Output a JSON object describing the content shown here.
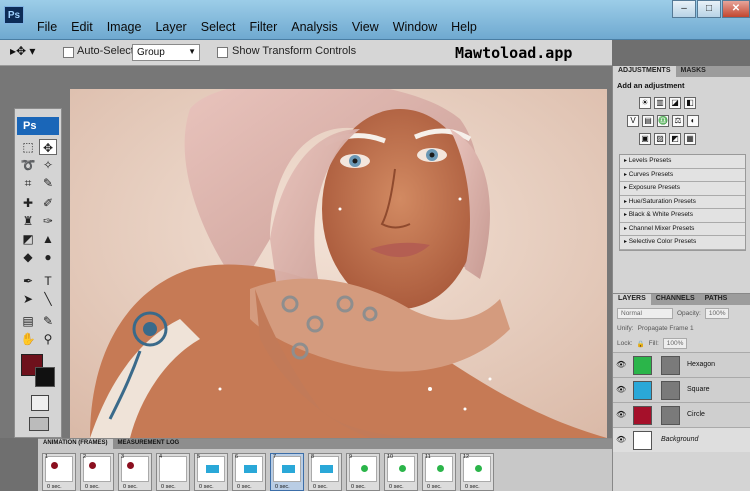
{
  "app": {
    "logo": "Ps"
  },
  "menu": [
    "File",
    "Edit",
    "Image",
    "Layer",
    "Select",
    "Filter",
    "Analysis",
    "View",
    "Window",
    "Help"
  ],
  "window_controls": {
    "minimize": "–",
    "maximize": "□",
    "close": "✕"
  },
  "options_bar": {
    "tool_preset": "▸✥ ▾",
    "auto_select_label": "Auto-Select:",
    "auto_select_value": "Group",
    "show_transform_label": "Show Transform Controls"
  },
  "watermark": "Mawtoload.app",
  "toolbox": {
    "badge": "Ps"
  },
  "colors": {
    "foreground": "#6e111c",
    "background": "#111111",
    "green": "#2bb54a",
    "cyan": "#2aa8d8",
    "red": "#a5102a"
  },
  "adjustments": {
    "tabs": [
      "ADJUSTMENTS",
      "MASKS"
    ],
    "title": "Add an adjustment",
    "row1": [
      "☀",
      "▥",
      "◪",
      "◧"
    ],
    "row2": [
      "V",
      "▤",
      "♎",
      "⚖",
      "◐"
    ],
    "row3": [
      "▣",
      "▨",
      "◩",
      "▦"
    ],
    "presets": [
      "Levels Presets",
      "Curves Presets",
      "Exposure Presets",
      "Hue/Saturation Presets",
      "Black & White Presets",
      "Channel Mixer Presets",
      "Selective Color Presets"
    ]
  },
  "layers_panel": {
    "tabs": [
      "LAYERS",
      "CHANNELS",
      "PATHS"
    ],
    "blend_mode": "Normal",
    "opacity_label": "Opacity:",
    "opacity_value": "100%",
    "unify_label": "Unify:",
    "propagate_label": "Propagate Frame 1",
    "lock_label": "Lock:",
    "fill_label": "Fill:",
    "fill_value": "100%",
    "layers": [
      {
        "name": "Hexagon",
        "color": "#2bb54a"
      },
      {
        "name": "Square",
        "color": "#2aa8d8"
      },
      {
        "name": "Circle",
        "color": "#a5102a"
      },
      {
        "name": "Background",
        "color": "#ffffff"
      }
    ]
  },
  "animation": {
    "tabs": [
      "ANIMATION (FRAMES)",
      "MEASUREMENT LOG"
    ],
    "frames": [
      {
        "num": "1",
        "delay": "0 sec.",
        "shape": "circle",
        "color": "#8b0f1f"
      },
      {
        "num": "2",
        "delay": "0 sec.",
        "shape": "circle",
        "color": "#8b0f1f"
      },
      {
        "num": "3",
        "delay": "0 sec.",
        "shape": "circle",
        "color": "#8b0f1f"
      },
      {
        "num": "4",
        "delay": "0 sec.",
        "shape": "none",
        "color": ""
      },
      {
        "num": "5",
        "delay": "0 sec.",
        "shape": "square",
        "color": "#2aa8d8"
      },
      {
        "num": "6",
        "delay": "0 sec.",
        "shape": "square",
        "color": "#2aa8d8"
      },
      {
        "num": "7",
        "delay": "0 sec.",
        "shape": "square",
        "color": "#2aa8d8"
      },
      {
        "num": "8",
        "delay": "0 sec.",
        "shape": "square",
        "color": "#2aa8d8"
      },
      {
        "num": "9",
        "delay": "0 sec.",
        "shape": "circle",
        "color": "#2bb54a"
      },
      {
        "num": "10",
        "delay": "0 sec.",
        "shape": "circle",
        "color": "#2bb54a"
      },
      {
        "num": "11",
        "delay": "0 sec.",
        "shape": "circle",
        "color": "#2bb54a"
      },
      {
        "num": "12",
        "delay": "0 sec.",
        "shape": "circle",
        "color": "#2bb54a"
      }
    ],
    "selected_frame": 7
  }
}
